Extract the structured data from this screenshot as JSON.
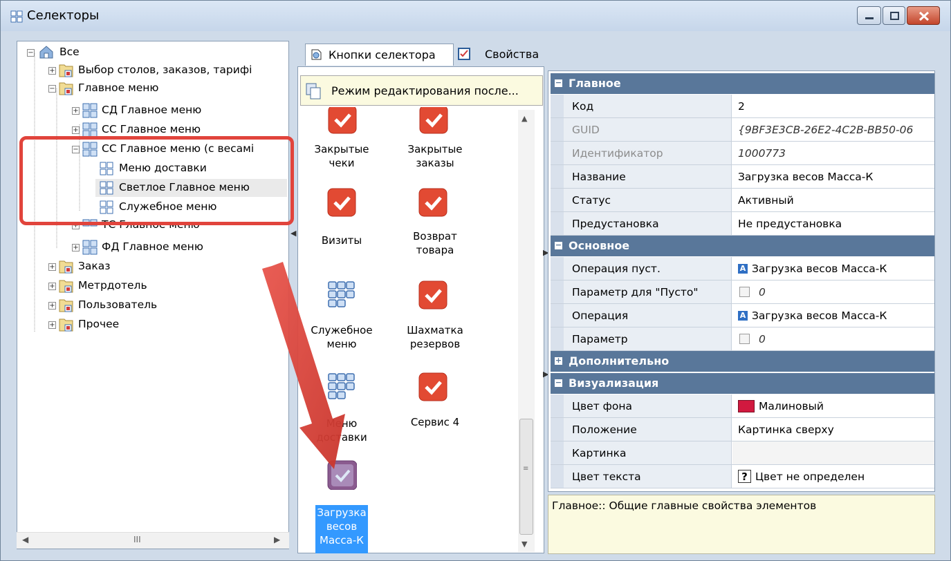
{
  "window": {
    "title": "Селекторы",
    "controls": [
      "minimize",
      "maximize",
      "close"
    ]
  },
  "tree": {
    "root": "Все",
    "items": [
      {
        "label": "Выбор столов, заказов, тарифі",
        "icon": "folder-grid-icon"
      },
      {
        "label": "Главное меню",
        "icon": "folder-grid-icon"
      },
      {
        "label": "СД Главное меню",
        "icon": "menu-grid-icon"
      },
      {
        "label": "СС Главное меню",
        "icon": "menu-grid-icon"
      },
      {
        "label": "СС Главное меню (с весамі",
        "icon": "menu-grid-icon"
      },
      {
        "label": "Меню доставки",
        "icon": "grid-icon"
      },
      {
        "label": "Светлое Главное меню",
        "icon": "grid-icon"
      },
      {
        "label": "Служебное меню",
        "icon": "grid-icon"
      },
      {
        "label": "ТС Главное меню",
        "icon": "menu-grid-icon"
      },
      {
        "label": "ФД Главное меню",
        "icon": "menu-grid-icon"
      },
      {
        "label": "Заказ",
        "icon": "folder-grid-icon"
      },
      {
        "label": "Метрдотель",
        "icon": "folder-grid-icon"
      },
      {
        "label": "Пользователь",
        "icon": "folder-grid-icon"
      },
      {
        "label": "Прочее",
        "icon": "folder-grid-icon"
      }
    ],
    "scroll_mark": "III"
  },
  "tabs": [
    {
      "label": "Кнопки селектора",
      "icon": "selector-buttons-icon",
      "active": true
    },
    {
      "label": "Свойства",
      "icon": "properties-icon",
      "active": false
    }
  ],
  "tooltip": "Режим редактирования после...",
  "tiles": [
    {
      "line1": "Закрытые",
      "line2": "чеки",
      "icon": "check-icon"
    },
    {
      "line1": "Закрытые",
      "line2": "заказы",
      "icon": "check-icon"
    },
    {
      "line1": "Визиты",
      "line2": "",
      "icon": "check-icon"
    },
    {
      "line1": "Возврат",
      "line2": "товара",
      "icon": "check-icon"
    },
    {
      "line1": "Служебное",
      "line2": "меню",
      "icon": "menu-grid-icon"
    },
    {
      "line1": "Шахматка",
      "line2": "резервов",
      "icon": "check-icon"
    },
    {
      "line1": "Меню",
      "line2": "доставки",
      "icon": "menu-grid-icon"
    },
    {
      "line1": "Сервис 4",
      "line2": "",
      "icon": "check-icon"
    },
    {
      "line1": "Загрузка",
      "line2": "весов",
      "line3": "Масса-К",
      "icon": "check-icon",
      "selected": true
    }
  ],
  "properties": {
    "categories": {
      "main": "Главное",
      "basic": "Основное",
      "extra": "Дополнительно",
      "visual": "Визуализация"
    },
    "main_rows": [
      {
        "name": "Код",
        "value": "2"
      },
      {
        "name": "GUID",
        "value": "{9BF3E3CB-26E2-4C2B-BB50-06",
        "greyed": true
      },
      {
        "name": "Идентификатор",
        "value": "1000773",
        "greyed": true
      },
      {
        "name": "Название",
        "value": "Загрузка весов Масса-К"
      },
      {
        "name": "Статус",
        "value": "Активный"
      },
      {
        "name": "Предустановка",
        "value": "Не предустановка"
      }
    ],
    "basic_rows": [
      {
        "name": "Операция пуст.",
        "value": "Загрузка весов Масса-К"
      },
      {
        "name": "Параметр для \"Пусто\"",
        "value": "0"
      },
      {
        "name": "Операция",
        "value": "Загрузка весов Масса-К"
      },
      {
        "name": "Параметр",
        "value": "0"
      }
    ],
    "visual_rows": [
      {
        "name": "Цвет фона",
        "value": "Малиновый",
        "swatch": "#d1193f"
      },
      {
        "name": "Положение",
        "value": "Картинка сверху"
      },
      {
        "name": "Картинка",
        "value": ""
      },
      {
        "name": "Цвет текста",
        "value": "Цвет не определен",
        "mark": "?"
      }
    ]
  },
  "description": "Главное:: Общие главные свойства элементов",
  "colors": {
    "accent": "#3399ff",
    "category_header": "#59779a",
    "tile_red": "#e24a33",
    "annotation_red": "#e1443c"
  }
}
